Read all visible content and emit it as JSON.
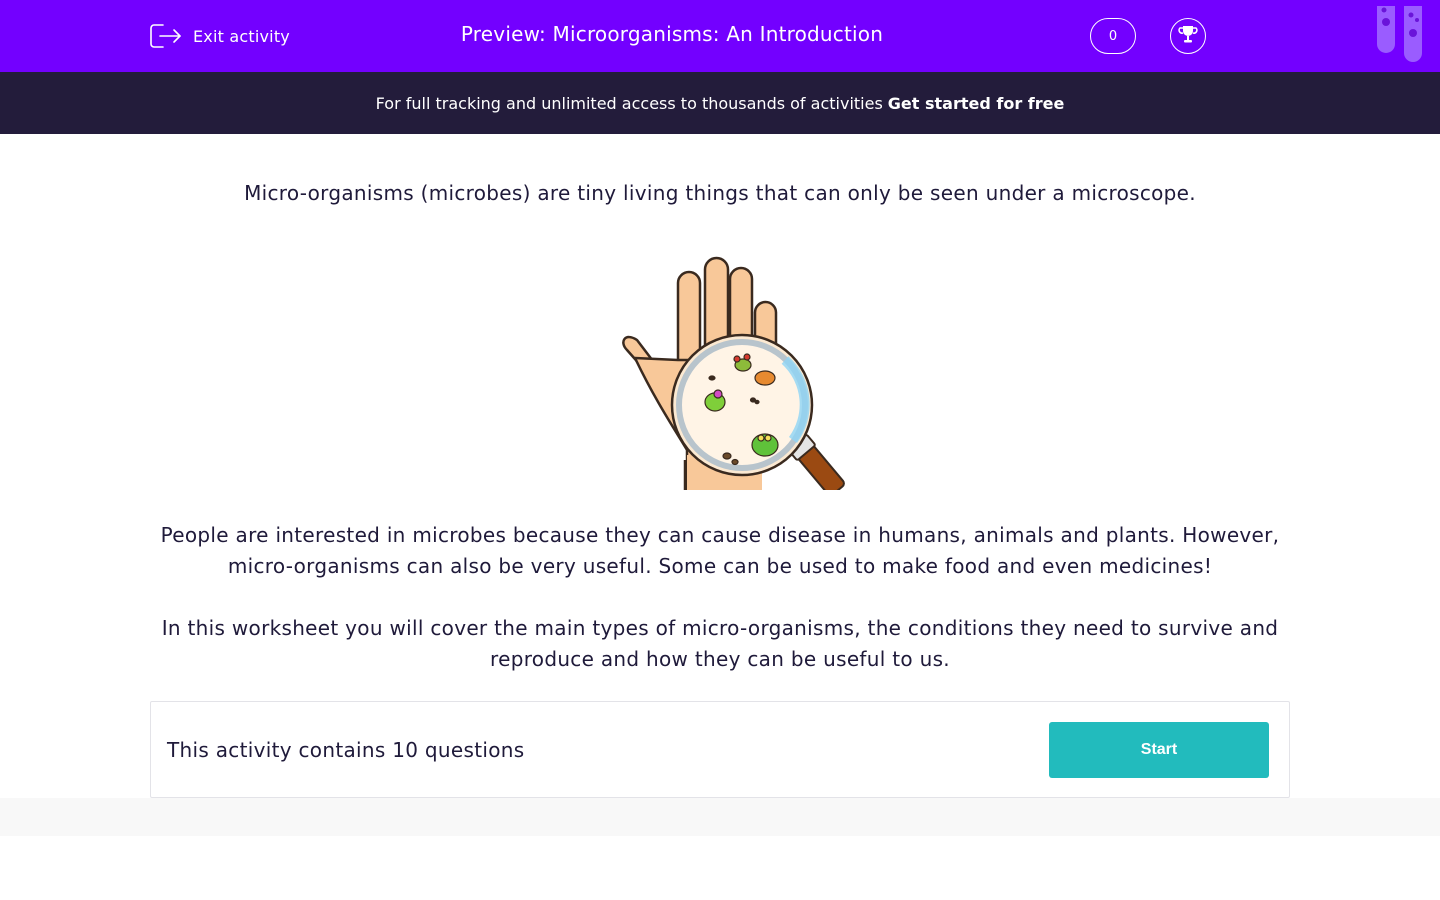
{
  "header": {
    "exit_label": "Exit activity",
    "title": "Preview: Microorganisms: An Introduction",
    "score": "0"
  },
  "banner": {
    "text": "For full tracking and unlimited access to thousands of activities",
    "cta": "Get started for free"
  },
  "content": {
    "intro": "Micro-organisms (microbes) are tiny living things that can only be seen under a microscope.",
    "paragraph1": "People are interested in microbes because they can cause disease in humans, animals and plants. However, micro-organisms can also be very useful. Some can be used to make food and even medicines!",
    "paragraph2": "In this worksheet you will cover the main types of micro-organisms, the conditions they need to survive and reproduce and how they can be useful to us."
  },
  "activity": {
    "question_count_text": "This activity contains 10 questions",
    "start_label": "Start"
  },
  "colors": {
    "header_bg": "#7300ff",
    "banner_bg": "#231c3b",
    "start_button": "#22bbbd",
    "text": "#1f1a3a"
  },
  "icons": [
    "exit-icon",
    "trophy-icon",
    "test-tubes-logo",
    "hand-magnifier-illustration"
  ]
}
